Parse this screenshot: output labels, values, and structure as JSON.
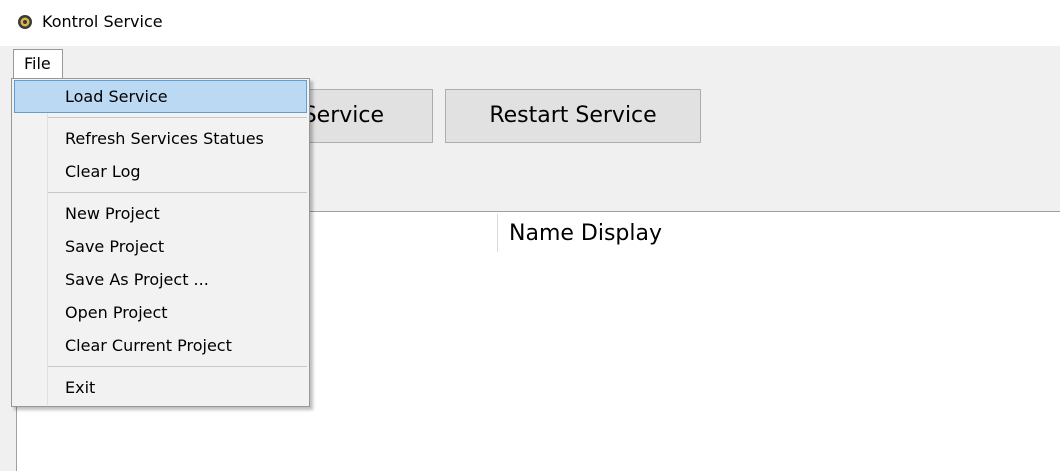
{
  "window": {
    "title": "Kontrol Service",
    "icon": "gear-icon"
  },
  "menubar": {
    "file_label": "File"
  },
  "toolbar": {
    "service_button_label": "Service",
    "restart_button_label": "Restart Service"
  },
  "list": {
    "column_name_display": "Name Display"
  },
  "file_menu": {
    "items": [
      {
        "label": "Load Service",
        "highlighted": true
      },
      {
        "label": "Refresh Services Statues"
      },
      {
        "label": "Clear Log"
      },
      {
        "label": "New Project"
      },
      {
        "label": "Save Project"
      },
      {
        "label": "Save As Project ..."
      },
      {
        "label": "Open Project"
      },
      {
        "label": "Clear Current Project"
      },
      {
        "label": "Exit"
      }
    ]
  },
  "colors": {
    "menu_highlight": "#bbd9f3",
    "menu_highlight_border": "#5f9fd6",
    "button_face": "#e1e1e1"
  }
}
